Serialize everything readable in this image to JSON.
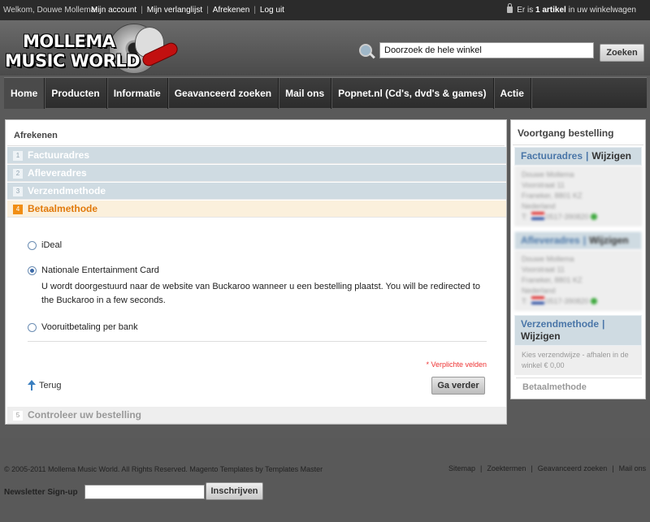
{
  "topbar": {
    "welcome": "Welkom, Douwe Mollema!",
    "links": [
      "Mijn account",
      "Mijn verlanglijst",
      "Afrekenen",
      "Log uit"
    ],
    "cart_prefix": "Er is ",
    "cart_count": "1 artikel",
    "cart_suffix": " in uw winkelwagen"
  },
  "header": {
    "logo_line1": "MOLLEMA",
    "logo_line2": "MUSIC WORLD",
    "search_value": "Doorzoek de hele winkel",
    "search_button": "Zoeken"
  },
  "nav": [
    "Home",
    "Producten",
    "Informatie",
    "Geavanceerd zoeken",
    "Mail ons",
    "Popnet.nl (Cd's, dvd's & games)",
    "Actie"
  ],
  "checkout": {
    "title": "Afrekenen",
    "steps": [
      {
        "num": "1",
        "label": "Factuuradres"
      },
      {
        "num": "2",
        "label": "Afleveradres"
      },
      {
        "num": "3",
        "label": "Verzendmethode"
      },
      {
        "num": "4",
        "label": "Betaalmethode"
      },
      {
        "num": "5",
        "label": "Controleer uw bestelling"
      }
    ],
    "payment_options": [
      {
        "label": "iDeal",
        "selected": false
      },
      {
        "label": "Nationale Entertainment Card",
        "selected": true
      },
      {
        "label": "Vooruitbetaling per bank",
        "selected": false
      }
    ],
    "selected_description": "U wordt doorgestuurd naar de website van Buckaroo wanneer u een bestelling plaatst. You will be redirected to the Buckaroo in a few seconds.",
    "required_note": "* Verplichte velden",
    "back_label": "Terug",
    "continue_button": "Ga verder"
  },
  "progress": {
    "title": "Voortgang bestelling",
    "edit_label": "Wijzigen",
    "billing": {
      "label": "Factuuradres",
      "lines": [
        "Douwe Mollema",
        "Voorstraat 11",
        "Franeker, 8801 KZ",
        "Nederland"
      ],
      "phone": "0517-390820"
    },
    "shipping": {
      "label": "Afleveradres",
      "lines": [
        "Douwe Mollema",
        "Voorstraat 11",
        "Franeker, 8801 KZ",
        "Nederland"
      ],
      "phone": "0517-390820"
    },
    "method": {
      "label": "Verzendmethode",
      "text": "Kies verzendwijze - afhalen in de winkel € 0,00"
    },
    "payment_label": "Betaalmethode"
  },
  "footer": {
    "copyright": "© 2005-2011 Mollema Music World. All Rights Reserved. Magento Templates by Templates Master",
    "links": [
      "Sitemap",
      "Zoektermen",
      "Geavanceerd zoeken",
      "Mail ons"
    ],
    "newsletter_label": "Newsletter Sign-up",
    "newsletter_button": "Inschrijven"
  },
  "colors": {
    "accent_orange": "#e17a0c",
    "step_blue": "#cfdbe2",
    "link_blue": "#4a76a8"
  }
}
